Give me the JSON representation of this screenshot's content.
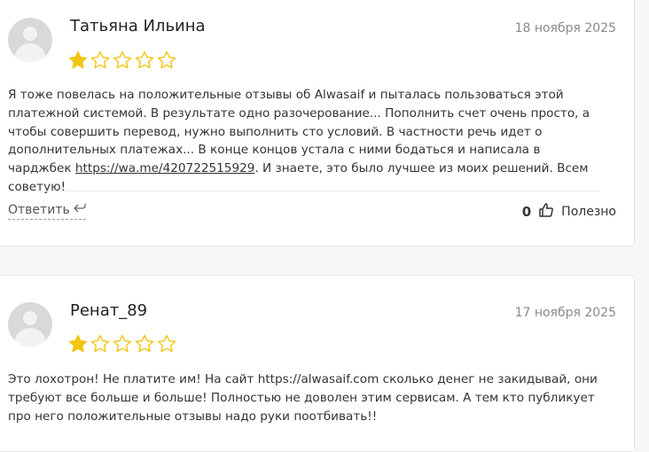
{
  "reviews": [
    {
      "author": "Татьяна Ильина",
      "date": "18 ноября 2025",
      "rating": 1,
      "rating_max": 5,
      "text_before_link": "Я тоже повелась на положительные отзывы об Alwasaif и пыталась пользоваться этой платежной системой. В результате одно разочерование... Пополнить счет очень просто, а чтобы совершить перевод, нужно выполнить сто условий. В частности речь идет о дополнительных платежах... В конце концов устала с ними бодаться и написала в чарджбек ",
      "link": "https://wa.me/420722515929",
      "text_after_link": ". И знаете, это было лучшее из моих решений. Всем советую!",
      "reply_label": "Ответить",
      "likes": "0",
      "helpful_label": "Полезно"
    },
    {
      "author": "Ренат_89",
      "date": "17 ноября 2025",
      "rating": 1,
      "rating_max": 5,
      "text": "Это лохотрон! Не платите им! На сайт https://alwasaif.com сколько денег не закидывай, они требуют все больше и больше! Полностью не доволен этим сервисам. А тем кто публикует про него положительные отзывы надо руки поотбивать!!"
    }
  ],
  "colors": {
    "star_filled": "#f2c511",
    "star_outline": "#f2c511",
    "avatar": "#d9d9d9"
  }
}
